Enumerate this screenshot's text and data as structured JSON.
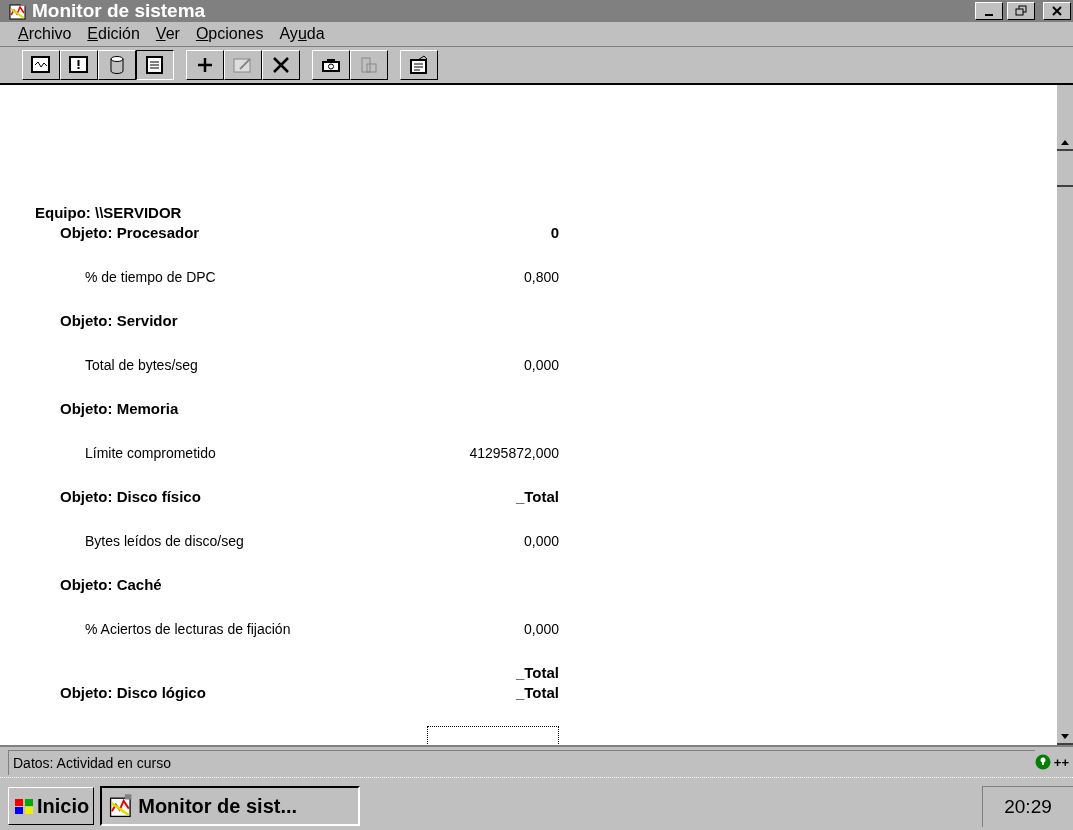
{
  "window": {
    "title": "Monitor de sistema"
  },
  "menu": [
    {
      "key": "A",
      "after": "rchivo"
    },
    {
      "key": "E",
      "after": "dición"
    },
    {
      "key": "V",
      "after": "er"
    },
    {
      "key": "O",
      "after": "pciones"
    },
    {
      "before": "Ay",
      "key": "u",
      "after": "da"
    }
  ],
  "toolbar": [
    [
      {
        "kind": "chart",
        "selected": false,
        "disabled": false
      },
      {
        "kind": "alert",
        "selected": false,
        "disabled": false
      },
      {
        "kind": "log",
        "selected": false,
        "disabled": false
      },
      {
        "kind": "report",
        "selected": true,
        "disabled": false
      }
    ],
    [
      {
        "kind": "add",
        "selected": false,
        "disabled": false
      },
      {
        "kind": "edit",
        "selected": false,
        "disabled": true
      },
      {
        "kind": "delete",
        "selected": false,
        "disabled": false
      }
    ],
    [
      {
        "kind": "bookmark",
        "selected": false,
        "disabled": false
      },
      {
        "kind": "update",
        "selected": false,
        "disabled": true
      }
    ],
    [
      {
        "kind": "options",
        "selected": false,
        "disabled": false
      }
    ]
  ],
  "report": {
    "computer": "Equipo: \\\\SERVIDOR",
    "sections": [
      {
        "object": "Objeto: Procesador",
        "instances": [
          "0"
        ],
        "counters": [
          {
            "name": "% de tiempo de DPC",
            "value": "0,800"
          }
        ]
      },
      {
        "object": "Objeto: Servidor",
        "counters": [
          {
            "name": "Total de bytes/seg",
            "value": "0,000"
          }
        ]
      },
      {
        "object": "Objeto: Memoria",
        "counters": [
          {
            "name": "Límite comprometido",
            "value": "41295872,000"
          }
        ]
      },
      {
        "object": "Objeto: Disco físico",
        "instances": [
          "_Total"
        ],
        "counters": [
          {
            "name": "Bytes leídos de disco/seg",
            "value": "0,000"
          }
        ]
      },
      {
        "object": "Objeto: Caché",
        "counters": [
          {
            "name": "% Aciertos de lecturas de fijación",
            "value": "0,000"
          }
        ]
      },
      {
        "object": "Objeto: Disco lógico",
        "instances": [
          "_Total",
          "_Total"
        ]
      }
    ]
  },
  "status_bar": {
    "text": "Datos: Actividad en curso",
    "indicator": "++"
  },
  "taskbar": {
    "start": "Inicio",
    "tasks": [
      {
        "label": "Monitor de sist...",
        "selected": true
      }
    ],
    "clock": "20:29"
  }
}
